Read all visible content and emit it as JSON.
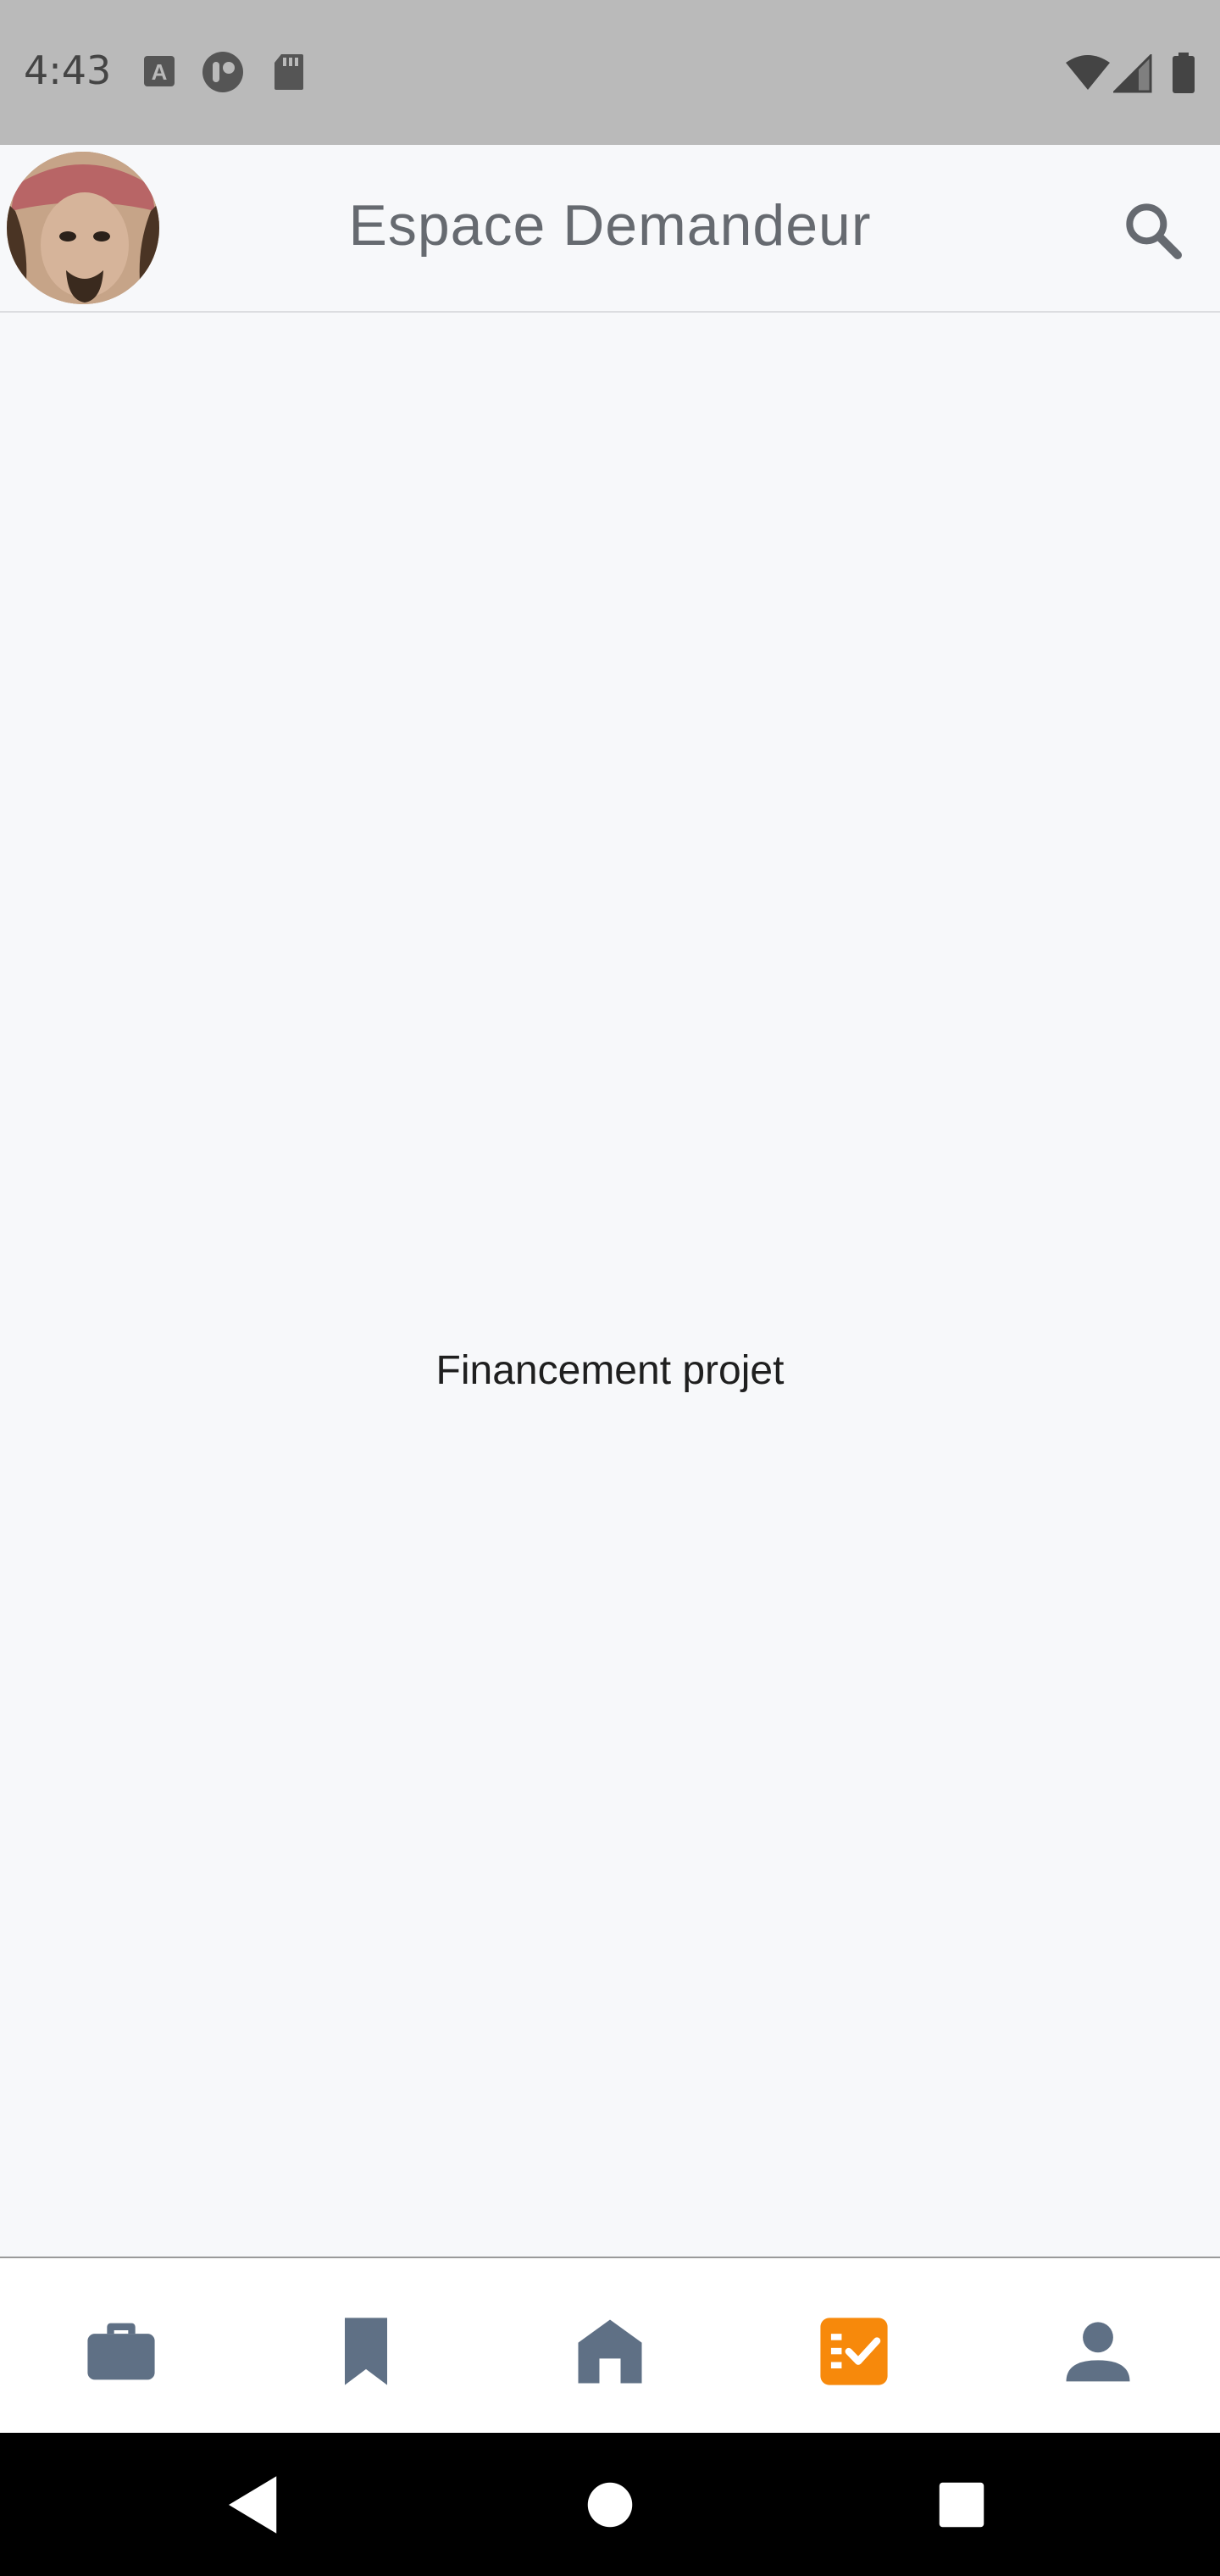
{
  "status_bar": {
    "time": "4:43",
    "left_icons": [
      "a-box-icon",
      "toggle-circle-icon",
      "sd-card-icon"
    ],
    "right_icons": [
      "wifi-icon",
      "signal-icon",
      "battery-icon"
    ]
  },
  "app_bar": {
    "title": "Espace Demandeur",
    "avatar_icon": "avatar",
    "search_icon": "search-icon"
  },
  "content": {
    "label": "Financement projet"
  },
  "bottom_nav": {
    "items": [
      {
        "icon": "briefcase-icon",
        "active": false
      },
      {
        "icon": "bookmark-icon",
        "active": false
      },
      {
        "icon": "home-icon",
        "active": false
      },
      {
        "icon": "checklist-icon",
        "active": true
      },
      {
        "icon": "person-icon",
        "active": false
      }
    ],
    "active_color": "#f7890b",
    "inactive_color": "#5f7085"
  },
  "system_nav": {
    "buttons": [
      "back-icon",
      "home-circle-icon",
      "recents-icon"
    ]
  }
}
